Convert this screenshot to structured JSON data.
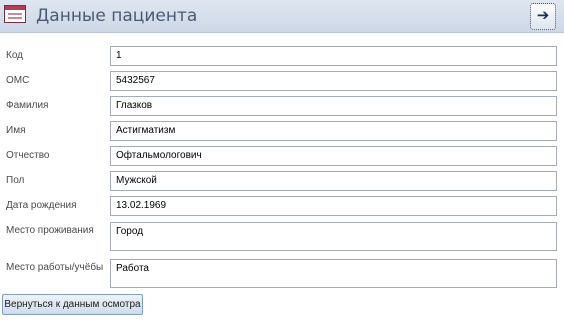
{
  "form": {
    "title": "Данные пациента",
    "nav_button_icon": "arrow-right-icon",
    "nav_button_glyph": "➔"
  },
  "fields": [
    {
      "label": "Код",
      "value": "1"
    },
    {
      "label": "ОМС",
      "value": "5432567"
    },
    {
      "label": "Фамилия",
      "value": "Глазков"
    },
    {
      "label": "Имя",
      "value": "Астигматизм"
    },
    {
      "label": "Отчество",
      "value": "Офтальмологович"
    },
    {
      "label": "Пол",
      "value": "Мужской"
    },
    {
      "label": "Дата рождения",
      "value": "13.02.1969"
    },
    {
      "label": "Место проживания",
      "value": "Город"
    },
    {
      "label": "Место работы/учёбы",
      "value": "Работа"
    }
  ],
  "actions": {
    "back_label": "Вернуться к данным осмотра"
  },
  "colors": {
    "header_bg": "#d6deeb",
    "title_text": "#4a5a74",
    "field_border": "#a5acb5",
    "button_border": "#7f9fc4"
  }
}
